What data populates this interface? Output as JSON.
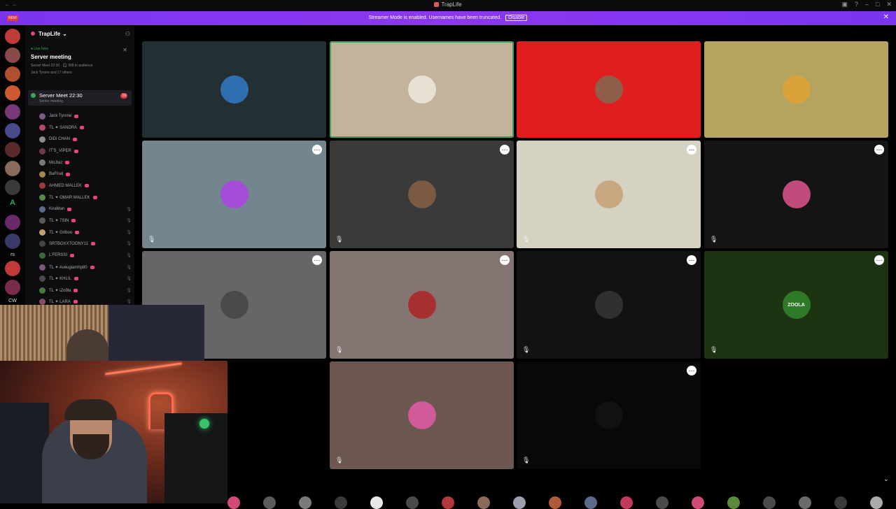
{
  "window": {
    "title": "TrapLife"
  },
  "banner": {
    "text": "Streamer Mode is enabled. Usernames have been truncated.",
    "button": "Disable"
  },
  "server": {
    "name": "TrapLife"
  },
  "live": {
    "label": "● Live Now",
    "name": "Server meeting",
    "line1": "Server Meet 22:30 · 🎧 368 in audience",
    "line2": "Jack Tyrone and 17 others"
  },
  "channel": {
    "name": "Server Meet 22:30",
    "sub": "Server meeting",
    "badge": "19"
  },
  "members": [
    {
      "name": "Jack Tyrone",
      "color": "#7a5b8c"
    },
    {
      "name": "TL ✦ SANDRA",
      "color": "#b34a6a"
    },
    {
      "name": "DiDi CHAN",
      "color": "#8d8d8d"
    },
    {
      "name": "IT'S_VIPER",
      "color": "#6d3b4a"
    },
    {
      "name": "MoJtaz",
      "color": "#7a7a7a"
    },
    {
      "name": "BaFirali",
      "color": "#a5864d"
    },
    {
      "name": "AHMED MALLEK",
      "color": "#a33a3a"
    },
    {
      "name": "TL ✦ OMAR MALLEK",
      "color": "#5a8a4a"
    },
    {
      "name": "KiraMan",
      "color": "#5a6a8a"
    },
    {
      "name": "TL ✦ 7SIN",
      "color": "#5a5a5a"
    },
    {
      "name": "TL ✦ Gribou",
      "color": "#c4a070"
    },
    {
      "name": "SRTBOXXTOONY11",
      "color": "#444"
    },
    {
      "name": "L'FERSSI",
      "color": "#3a6a3a"
    },
    {
      "name": "TL ✦ Aveugiamhp80",
      "color": "#7a5a7a"
    },
    {
      "name": "TL ✦ KHLIL",
      "color": "#4a4a4a"
    },
    {
      "name": "TL ✦ iZo9la",
      "color": "#4a7a3a"
    },
    {
      "name": "TL ✦ LARA",
      "color": "#8a4a6a"
    }
  ],
  "rail": {
    "new_badge": "NEW",
    "letter": "A",
    "text1": "rs",
    "text2": "CW"
  },
  "tiles": [
    {
      "bg": "#233033",
      "av": "#2f6fb0",
      "ring": "",
      "more": false,
      "mic": false
    },
    {
      "bg": "#c3b39b",
      "av": "#e9e0d4",
      "ring": "#3ba55d",
      "more": false,
      "mic": false
    },
    {
      "bg": "#e01e1e",
      "av": "#8e5e4a",
      "ring": "",
      "more": false,
      "mic": false
    },
    {
      "bg": "#b5a45e",
      "av": "#d9a23a",
      "ring": "",
      "more": false,
      "mic": false
    },
    {
      "bg": "#73858e",
      "av": "#a64dd8",
      "ring": "",
      "more": true,
      "mic": true
    },
    {
      "bg": "#3a3a3a",
      "av": "#7a5a42",
      "ring": "",
      "more": true,
      "mic": true
    },
    {
      "bg": "#d5d2c1",
      "av": "#c8a880",
      "ring": "",
      "more": true,
      "mic": true
    },
    {
      "bg": "#141414",
      "av": "#c04a7a",
      "ring": "",
      "more": true,
      "mic": true
    },
    {
      "bg": "#666666",
      "av": "#4a4a4a",
      "ring": "",
      "more": true,
      "mic": false
    },
    {
      "bg": "#857572",
      "av": "#a83030",
      "ring": "",
      "more": true,
      "mic": true
    },
    {
      "bg": "#121212",
      "av": "#303030",
      "ring": "",
      "more": true,
      "mic": true
    },
    {
      "bg": "#1c3412",
      "av": "#2e7a28",
      "ring": "",
      "more": true,
      "mic": true
    },
    {
      "bg": "#6b574f",
      "av": "#d05a9a",
      "ring": "",
      "more": false,
      "mic": true
    },
    {
      "bg": "#080808",
      "av": "#111111",
      "ring": "",
      "more": true,
      "mic": true
    }
  ],
  "tile_labels": [
    "",
    "",
    "",
    "",
    "",
    "",
    "",
    "",
    "",
    "",
    "",
    "ZOOLA",
    "",
    ""
  ],
  "icons": {
    "more": "more-options-icon",
    "mic": "mic-muted-icon",
    "close": "close-icon",
    "chevron": "chevron-down-icon"
  }
}
